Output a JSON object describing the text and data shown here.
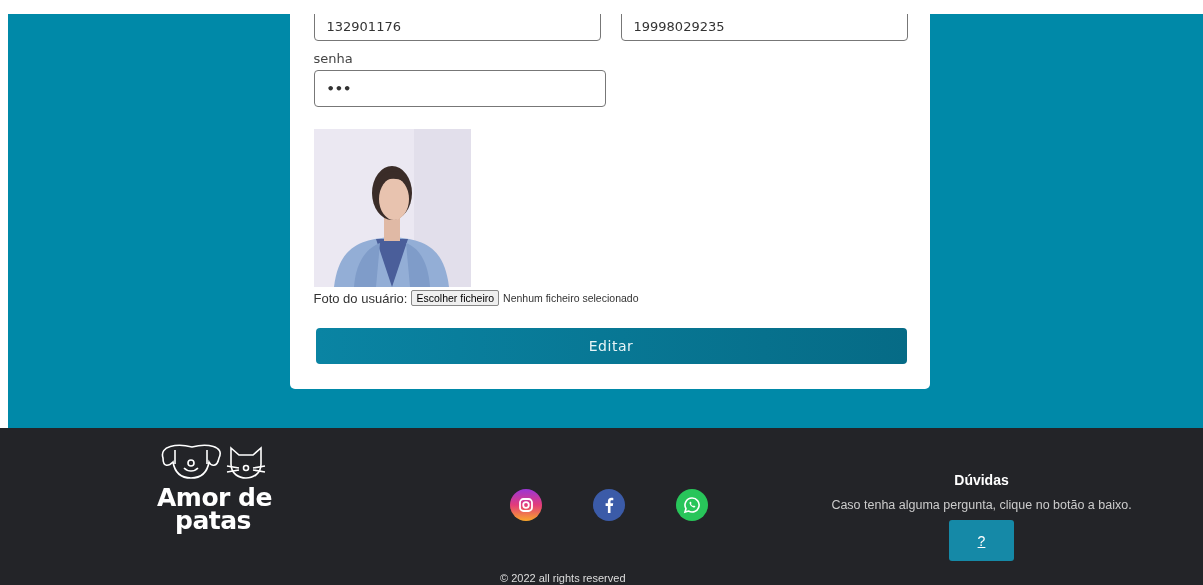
{
  "form": {
    "fields": [
      {
        "value": "132901176"
      },
      {
        "value": "19998029235"
      }
    ],
    "password": {
      "label": "senha",
      "value": "•••"
    },
    "file_input": {
      "label": "Foto do usuário:",
      "button": "Escolher ficheiro",
      "status": "Nenhum ficheiro selecionado"
    },
    "submit": "Editar"
  },
  "footer": {
    "logo": {
      "line_1": "Amor de",
      "line_2": "patas"
    },
    "social": [
      {
        "kind": "instagram"
      },
      {
        "kind": "facebook"
      },
      {
        "kind": "whatsapp"
      }
    ],
    "help": {
      "title": "Dúvidas",
      "text": "Caso tenha alguma pergunta, clique no botão a baixo.",
      "button": "?"
    },
    "copyright": "© 2022 all rights reserved"
  }
}
